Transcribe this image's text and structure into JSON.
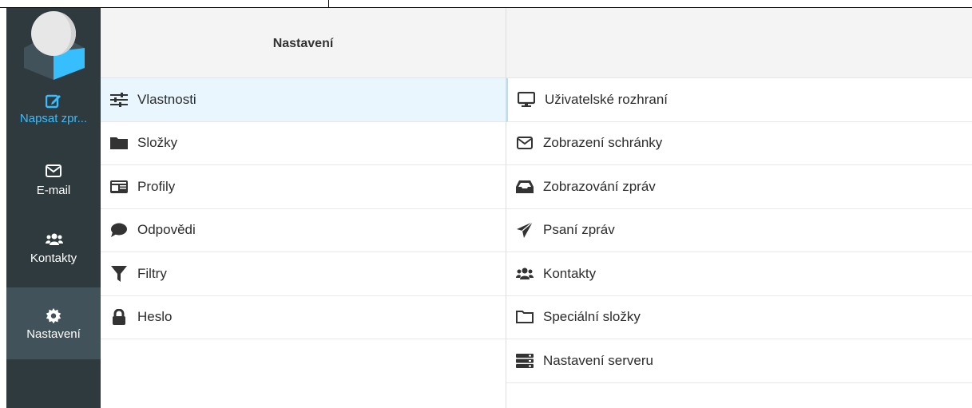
{
  "colors": {
    "rail_bg": "#2f3a3f",
    "rail_active_bg": "#41525a",
    "accent": "#37beff",
    "selected_bg": "#e9f6fe"
  },
  "nav": {
    "compose": {
      "label": "Napsat zpr...",
      "icon": "compose-icon"
    },
    "mail": {
      "label": "E-mail",
      "icon": "envelope-icon"
    },
    "contacts": {
      "label": "Kontakty",
      "icon": "users-icon"
    },
    "settings": {
      "label": "Nastavení",
      "icon": "gear-icon"
    }
  },
  "settings_panel": {
    "title": "Nastavení",
    "items": [
      {
        "label": "Vlastnosti",
        "icon": "sliders-icon"
      },
      {
        "label": "Složky",
        "icon": "folder-icon"
      },
      {
        "label": "Profily",
        "icon": "id-card-icon"
      },
      {
        "label": "Odpovědi",
        "icon": "comment-icon"
      },
      {
        "label": "Filtry",
        "icon": "filter-icon"
      },
      {
        "label": "Heslo",
        "icon": "lock-icon"
      }
    ]
  },
  "sections_panel": {
    "title": "",
    "items": [
      {
        "label": "Uživatelské rozhraní",
        "icon": "monitor-icon"
      },
      {
        "label": "Zobrazení schránky",
        "icon": "envelope-outline-icon"
      },
      {
        "label": "Zobrazování zpráv",
        "icon": "inbox-icon"
      },
      {
        "label": "Psaní zpráv",
        "icon": "paper-plane-icon"
      },
      {
        "label": "Kontakty",
        "icon": "users-icon"
      },
      {
        "label": "Speciální složky",
        "icon": "folder-outline-icon"
      },
      {
        "label": "Nastavení serveru",
        "icon": "server-icon"
      }
    ]
  }
}
